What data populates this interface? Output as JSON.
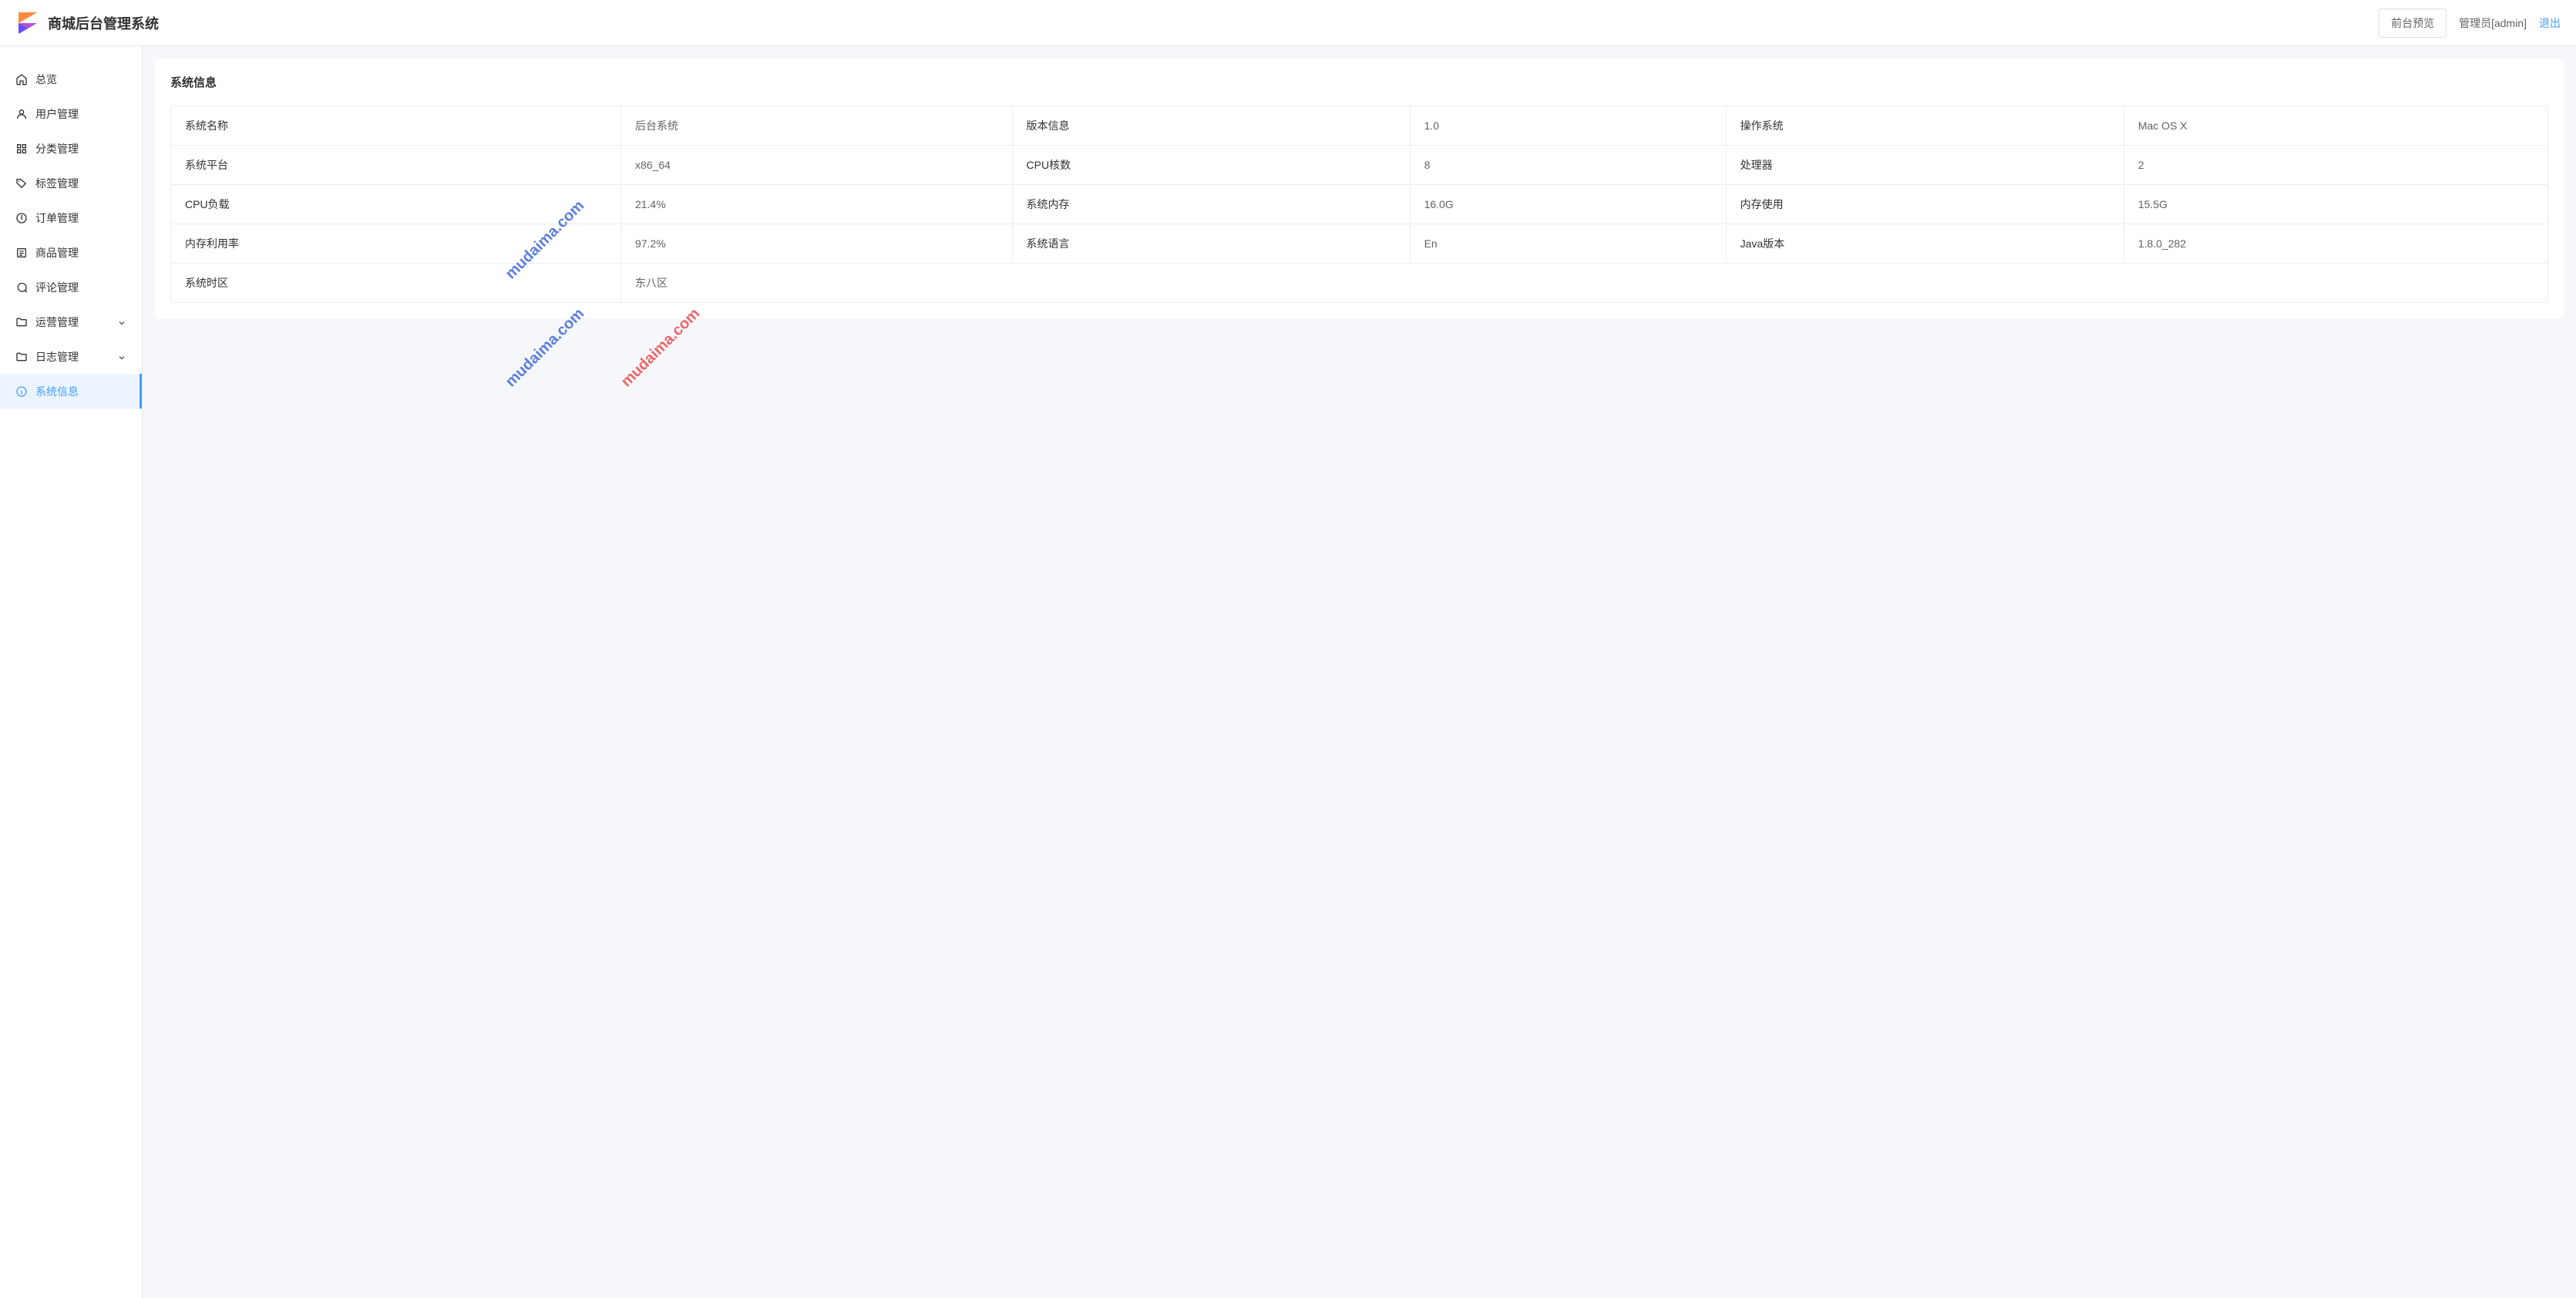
{
  "header": {
    "app_title": "商城后台管理系统",
    "preview_btn": "前台预览",
    "user_name": "管理员[admin]",
    "logout": "退出"
  },
  "sidebar": {
    "items": [
      {
        "label": "总览",
        "icon": "home-icon",
        "hasSub": false,
        "active": false
      },
      {
        "label": "用户管理",
        "icon": "user-icon",
        "hasSub": false,
        "active": false
      },
      {
        "label": "分类管理",
        "icon": "category-icon",
        "hasSub": false,
        "active": false
      },
      {
        "label": "标签管理",
        "icon": "tag-icon",
        "hasSub": false,
        "active": false
      },
      {
        "label": "订单管理",
        "icon": "order-icon",
        "hasSub": false,
        "active": false
      },
      {
        "label": "商品管理",
        "icon": "product-icon",
        "hasSub": false,
        "active": false
      },
      {
        "label": "评论管理",
        "icon": "comment-icon",
        "hasSub": false,
        "active": false
      },
      {
        "label": "运营管理",
        "icon": "folder-icon",
        "hasSub": true,
        "active": false
      },
      {
        "label": "日志管理",
        "icon": "folder-icon",
        "hasSub": true,
        "active": false
      },
      {
        "label": "系统信息",
        "icon": "info-icon",
        "hasSub": false,
        "active": true
      }
    ]
  },
  "main": {
    "title": "系统信息",
    "rows": [
      [
        {
          "label": "系统名称",
          "value": "后台系统"
        },
        {
          "label": "版本信息",
          "value": "1.0"
        },
        {
          "label": "操作系统",
          "value": "Mac OS X"
        }
      ],
      [
        {
          "label": "系统平台",
          "value": "x86_64"
        },
        {
          "label": "CPU核数",
          "value": "8"
        },
        {
          "label": "处理器",
          "value": "2"
        }
      ],
      [
        {
          "label": "CPU负载",
          "value": "21.4%"
        },
        {
          "label": "系统内存",
          "value": "16.0G"
        },
        {
          "label": "内存使用",
          "value": "15.5G"
        }
      ],
      [
        {
          "label": "内存利用率",
          "value": "97.2%"
        },
        {
          "label": "系统语言",
          "value": "En"
        },
        {
          "label": "Java版本",
          "value": "1.8.0_282"
        }
      ],
      [
        {
          "label": "系统时区",
          "value": "东八区"
        }
      ]
    ]
  },
  "watermark": "mudaima.com",
  "colors": {
    "primary": "#409eff",
    "active_bg": "#ecf5ff",
    "border": "#ebeef5"
  }
}
